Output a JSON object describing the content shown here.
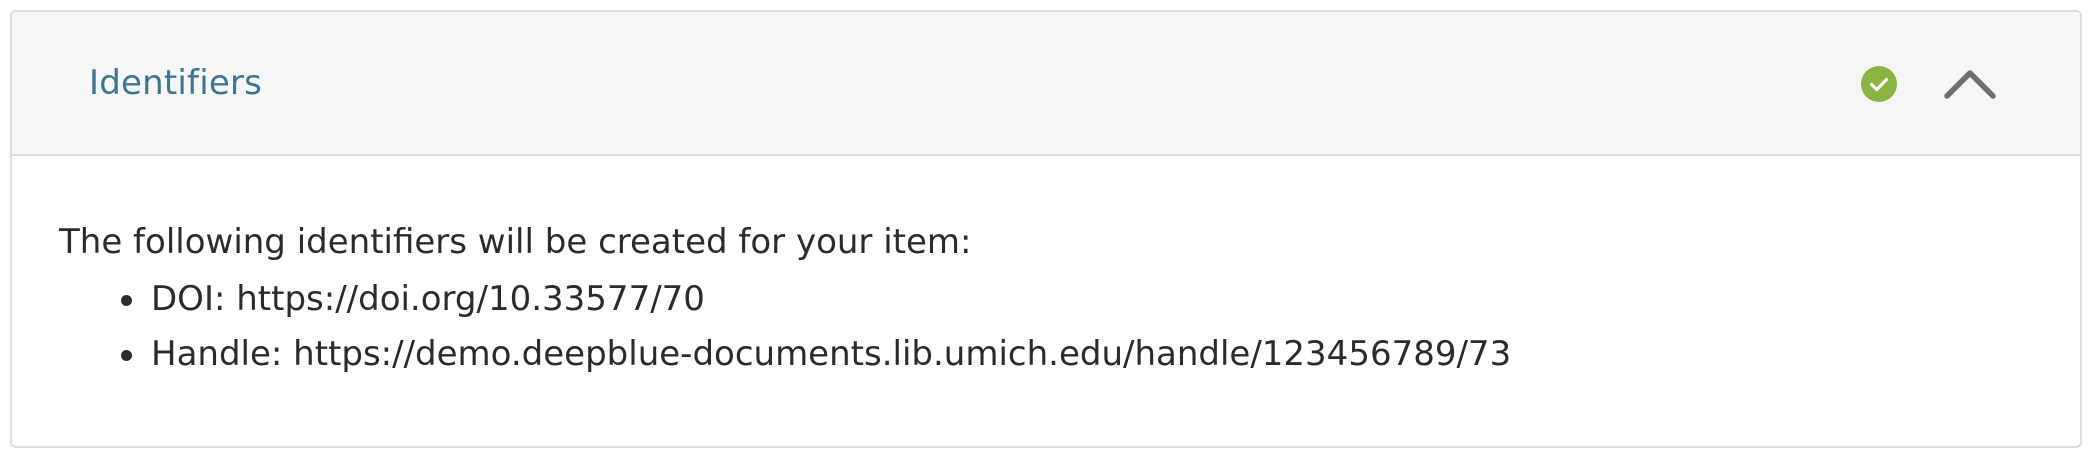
{
  "section": {
    "title": "Identifiers",
    "status_icon": "check-circle-icon",
    "status_color": "#8ab43f",
    "toggle_icon": "chevron-up-icon",
    "toggle_color": "#6f6f6f"
  },
  "body": {
    "intro": "The following identifiers will be created for your item:",
    "identifiers": [
      {
        "label": "DOI: ",
        "value": "https://doi.org/10.33577/70"
      },
      {
        "label": "Handle: ",
        "value": "https://demo.deepblue-documents.lib.umich.edu/handle/123456789/73"
      }
    ]
  }
}
